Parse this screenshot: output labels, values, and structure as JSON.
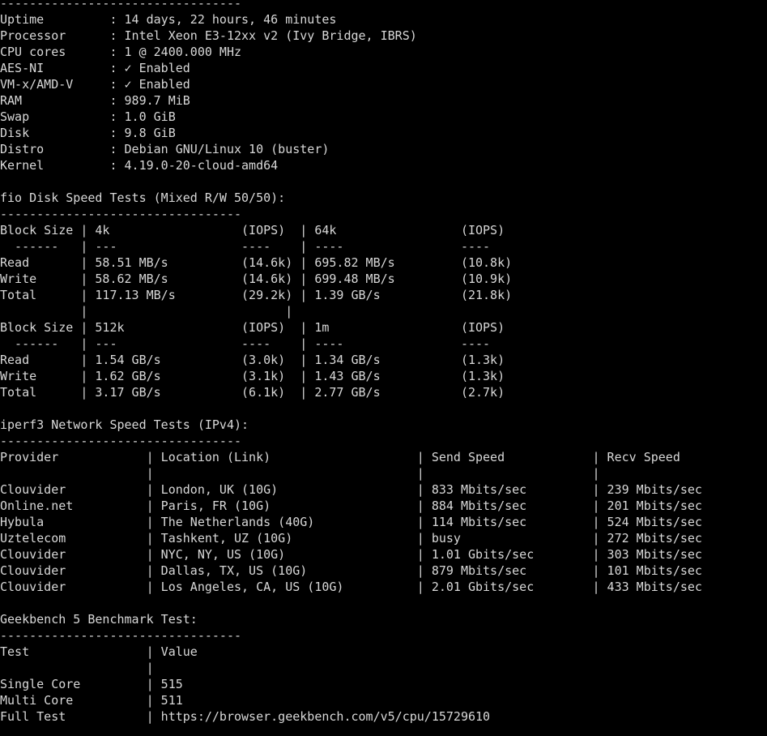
{
  "terminal": {
    "title": "yabs benchmark output",
    "background_color": "#000000",
    "foreground_color": "#d8d8d8",
    "columns": 118,
    "rows": 46
  },
  "divider_top": "---------------------------------",
  "system_info": {
    "label_width": 15,
    "rows": [
      {
        "label": "Uptime",
        "sep": ":",
        "value": "14 days, 22 hours, 46 minutes"
      },
      {
        "label": "Processor",
        "sep": ":",
        "value": "Intel Xeon E3-12xx v2 (Ivy Bridge, IBRS)"
      },
      {
        "label": "CPU cores",
        "sep": ":",
        "value": "1 @ 2400.000 MHz"
      },
      {
        "label": "AES-NI",
        "sep": ":",
        "value": "✓ Enabled"
      },
      {
        "label": "VM-x/AMD-V",
        "sep": ":",
        "value": "✓ Enabled"
      },
      {
        "label": "RAM",
        "sep": ":",
        "value": "989.7 MiB"
      },
      {
        "label": "Swap",
        "sep": ":",
        "value": "1.0 GiB"
      },
      {
        "label": "Disk",
        "sep": ":",
        "value": "9.8 GiB"
      },
      {
        "label": "Distro",
        "sep": ":",
        "value": "Debian GNU/Linux 10 (buster)"
      },
      {
        "label": "Kernel",
        "sep": ":",
        "value": "4.19.0-20-cloud-amd64"
      }
    ]
  },
  "fio": {
    "heading": "fio Disk Speed Tests (Mixed R/W 50/50):",
    "divider": "---------------------------------",
    "tables": [
      {
        "header_label": "Block Size",
        "col1_name": "4k",
        "col1_iops_header": "(IOPS)",
        "col2_name": "64k",
        "col2_iops_header": "(IOPS)",
        "dash_label": "------",
        "dash_col1": "---",
        "dash_col1_iops": "----",
        "dash_col2": "----",
        "dash_col2_iops": "----",
        "rows": [
          {
            "name": "Read",
            "col1_value": "58.51 MB/s",
            "col1_iops": "(14.6k)",
            "col2_value": "695.82 MB/s",
            "col2_iops": "(10.8k)"
          },
          {
            "name": "Write",
            "col1_value": "58.62 MB/s",
            "col1_iops": "(14.6k)",
            "col2_value": "699.48 MB/s",
            "col2_iops": "(10.9k)"
          },
          {
            "name": "Total",
            "col1_value": "117.13 MB/s",
            "col1_iops": "(29.2k)",
            "col2_value": "1.39 GB/s",
            "col2_iops": "(21.8k)"
          }
        ]
      },
      {
        "header_label": "Block Size",
        "col1_name": "512k",
        "col1_iops_header": "(IOPS)",
        "col2_name": "1m",
        "col2_iops_header": "(IOPS)",
        "dash_label": "------",
        "dash_col1": "---",
        "dash_col1_iops": "----",
        "dash_col2": "----",
        "dash_col2_iops": "----",
        "rows": [
          {
            "name": "Read",
            "col1_value": "1.54 GB/s",
            "col1_iops": "(3.0k)",
            "col2_value": "1.34 GB/s",
            "col2_iops": "(1.3k)"
          },
          {
            "name": "Write",
            "col1_value": "1.62 GB/s",
            "col1_iops": "(3.1k)",
            "col2_value": "1.43 GB/s",
            "col2_iops": "(1.3k)"
          },
          {
            "name": "Total",
            "col1_value": "3.17 GB/s",
            "col1_iops": "(6.1k)",
            "col2_value": "2.77 GB/s",
            "col2_iops": "(2.7k)"
          }
        ]
      }
    ]
  },
  "iperf3": {
    "heading": "iperf3 Network Speed Tests (IPv4):",
    "divider": "---------------------------------",
    "headers": {
      "provider": "Provider",
      "location": "Location (Link)",
      "send_speed": "Send Speed",
      "recv_speed": "Recv Speed"
    },
    "rows": [
      {
        "provider": "Clouvider",
        "location": "London, UK (10G)",
        "send": "833 Mbits/sec",
        "recv": "239 Mbits/sec"
      },
      {
        "provider": "Online.net",
        "location": "Paris, FR (10G)",
        "send": "884 Mbits/sec",
        "recv": "201 Mbits/sec"
      },
      {
        "provider": "Hybula",
        "location": "The Netherlands (40G)",
        "send": "114 Mbits/sec",
        "recv": "524 Mbits/sec"
      },
      {
        "provider": "Uztelecom",
        "location": "Tashkent, UZ (10G)",
        "send": "busy",
        "recv": "272 Mbits/sec"
      },
      {
        "provider": "Clouvider",
        "location": "NYC, NY, US (10G)",
        "send": "1.01 Gbits/sec",
        "recv": "303 Mbits/sec"
      },
      {
        "provider": "Clouvider",
        "location": "Dallas, TX, US (10G)",
        "send": "879 Mbits/sec",
        "recv": "101 Mbits/sec"
      },
      {
        "provider": "Clouvider",
        "location": "Los Angeles, CA, US (10G)",
        "send": "2.01 Gbits/sec",
        "recv": "433 Mbits/sec"
      }
    ]
  },
  "geekbench": {
    "heading": "Geekbench 5 Benchmark Test:",
    "divider": "---------------------------------",
    "headers": {
      "test": "Test",
      "value": "Value"
    },
    "rows": [
      {
        "test": "Single Core",
        "value": "515"
      },
      {
        "test": "Multi Core",
        "value": "511"
      },
      {
        "test": "Full Test",
        "value": "https://browser.geekbench.com/v5/cpu/15729610"
      }
    ]
  }
}
